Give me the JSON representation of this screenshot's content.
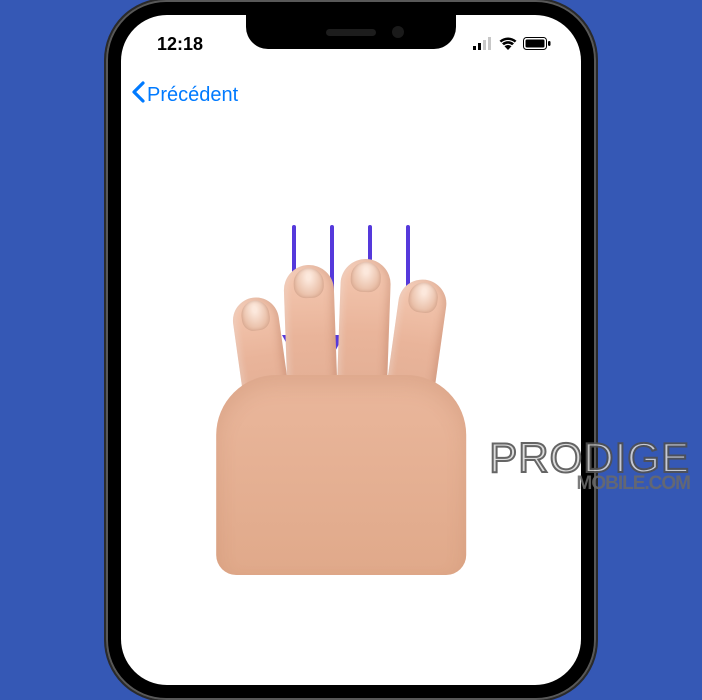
{
  "status": {
    "time": "12:18"
  },
  "nav": {
    "back_label": "Précédent"
  },
  "gesture": {
    "arrow_count": 4,
    "direction": "down"
  },
  "watermark": {
    "line1": "PRODIGE",
    "line2": "MOBILE.COM"
  }
}
